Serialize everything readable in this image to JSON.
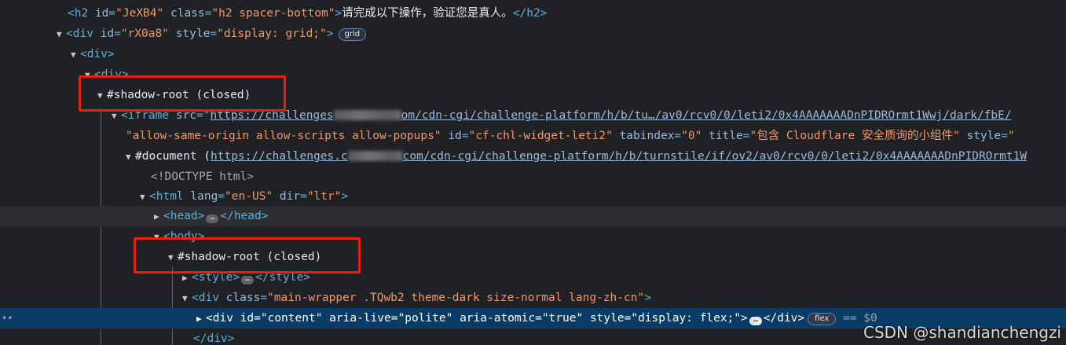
{
  "rows": {
    "h2": {
      "open": "<",
      "tag": "h2",
      "id_attr": "id",
      "id_val": "\"JeXB4\"",
      "class_attr": "class",
      "class_val": "\"h2 spacer-bottom\"",
      "close": ">",
      "text": "请完成以下操作，验证您是真人。",
      "end": "</h2>"
    },
    "div_grid": {
      "open": "<div",
      "id_attr": "id",
      "id_val": "\"rX0a8\"",
      "style_attr": "style",
      "style_val": "\"display: grid;\"",
      "close": ">",
      "badge": "grid"
    },
    "div1": {
      "text": "<div>"
    },
    "div2": {
      "text": "<div>"
    },
    "shadow1": {
      "text": "#shadow-root (closed)"
    },
    "iframe": {
      "open": "<iframe",
      "src_attr": "src",
      "eq": "=\"",
      "url_a": "https://challenges",
      "url_b": "om/cdn-cgi/challenge-platform/h/b/tu…/av0/rcv0/0/leti2/0x4AAAAAAADnPIDROrmt1Wwj/dark/fbE/"
    },
    "iframe2": {
      "sandbox_val": "\"allow-same-origin allow-scripts allow-popups\"",
      "id_attr": "id",
      "id_val": "\"cf-chl-widget-leti2\"",
      "tabindex_attr": "tabindex",
      "tabindex_val": "\"0\"",
      "title_attr": "title",
      "title_val": "\"包含 Cloudflare 安全质询的小组件\"",
      "style_attr": "style",
      "style_val": "\""
    },
    "document": {
      "label": "#document (",
      "url_a": "https://challenges.c",
      "url_b": "com/cdn-cgi/challenge-platform/h/b/turnstile/if/ov2/av0/rcv0/0/leti2/0x4AAAAAAADnPIDROrmt1W"
    },
    "doctype": {
      "text": "<!DOCTYPE html>"
    },
    "html": {
      "open": "<html",
      "lang_attr": "lang",
      "lang_val": "\"en-US\"",
      "dir_attr": "dir",
      "dir_val": "\"ltr\"",
      "close": ">"
    },
    "head": {
      "open": "<head>",
      "end": "</head>"
    },
    "body": {
      "text": "<body>"
    },
    "shadow2": {
      "text": "#shadow-root (closed)"
    },
    "style": {
      "open": "<style>",
      "end": "</style>"
    },
    "main_wrapper": {
      "open": "<div",
      "class_attr": "class",
      "class_val": "\"main-wrapper .TQwb2 theme-dark size-normal lang-zh-cn\"",
      "close": ">"
    },
    "content": {
      "open": "<div",
      "id_attr": "id",
      "id_val": "\"content\"",
      "aria_live_attr": "aria-live",
      "aria_live_val": "\"polite\"",
      "aria_atomic_attr": "aria-atomic",
      "aria_atomic_val": "\"true\"",
      "style_attr": "style",
      "style_val": "\"display: flex;\"",
      "close": ">",
      "end": "</div>",
      "badge": "flex",
      "eq0": "== $0"
    },
    "div_close": {
      "text": "</div>"
    }
  },
  "ellipsis": "…",
  "row_dots": "••",
  "watermark": "CSDN @shandianchengzi",
  "icons": {
    "expanded": "triangle-down-icon",
    "collapsed": "triangle-right-icon"
  },
  "colors": {
    "background": "#202124",
    "selection": "#083c67",
    "tag": "#5db0d7",
    "attr_name": "#9bbbdc",
    "attr_value": "#f29766",
    "highlight_box": "#e8200f"
  }
}
